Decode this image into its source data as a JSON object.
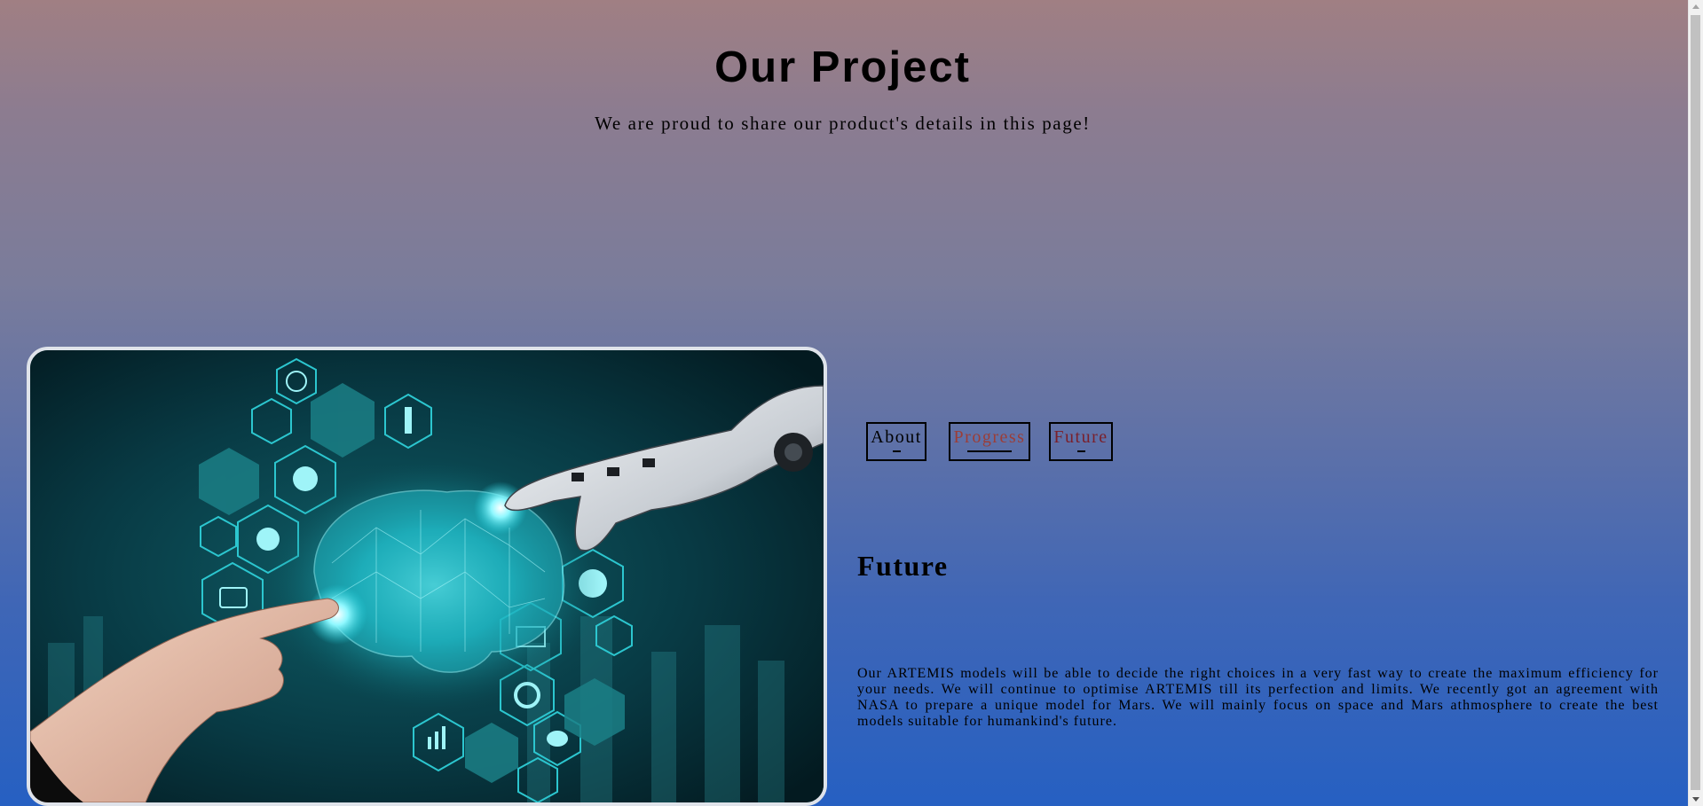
{
  "header": {
    "title": "Our Project",
    "subtitle": "We are proud to share our product's details in this page!"
  },
  "hero_image": {
    "alt": "Robot hand and human hand touching a glowing digital brain with technology icons",
    "icons": [
      "globe-icon",
      "conveyor-icon",
      "robot-arm-icon",
      "brain-head-icon",
      "gear-icon",
      "robot-face-icon",
      "settings-monitor-icon",
      "pie-chart-icon",
      "devices-icon",
      "analytics-gauge-icon",
      "bar-chart-icon",
      "line-graph-icon"
    ]
  },
  "tabs": [
    {
      "label": "About"
    },
    {
      "label": "Progress"
    },
    {
      "label": "Future"
    }
  ],
  "section": {
    "title": "Future",
    "body": "Our ARTEMIS models will be able to decide the right choices in a very fast way to create the maximum efficiency for your needs. We will continue to optimise ARTEMIS till its perfection and limits. We recently got an agreement with NASA to prepare a unique model for Mars. We will mainly focus on space and Mars athmosphere to create the best models suitable for humankind's future."
  },
  "colors": {
    "background_top": "#a07f83",
    "background_bottom": "#2660c2",
    "tab_progress_text": "#9c3d37",
    "tab_future_text": "#7a1f2a",
    "image_glow": "#29e0e8"
  }
}
